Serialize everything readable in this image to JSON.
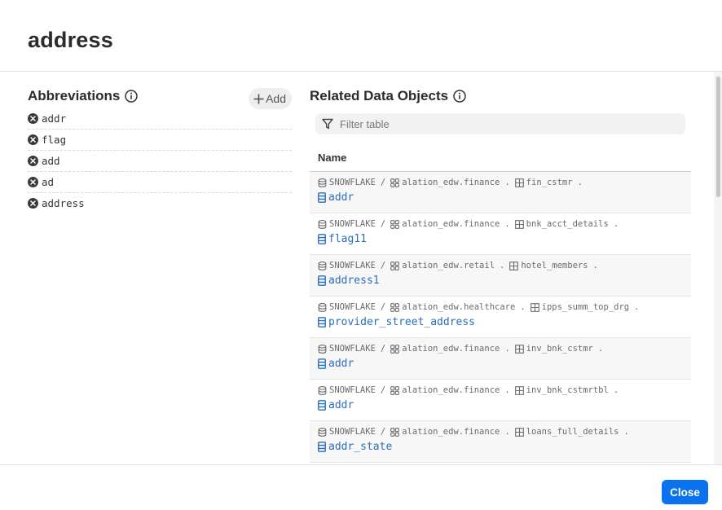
{
  "header": {
    "title": "address"
  },
  "abbreviations": {
    "title": "Abbreviations",
    "add_label": "Add",
    "items": [
      "addr",
      "flag",
      "add",
      "ad",
      "address"
    ]
  },
  "related": {
    "title": "Related Data Objects",
    "filter_placeholder": "Filter table",
    "column_header": "Name",
    "rows": [
      {
        "source": "SNOWFLAKE",
        "schema": "alation_edw.finance",
        "table": "fin_cstmr",
        "column": "addr"
      },
      {
        "source": "SNOWFLAKE",
        "schema": "alation_edw.finance",
        "table": "bnk_acct_details",
        "column": "flag11"
      },
      {
        "source": "SNOWFLAKE",
        "schema": "alation_edw.retail",
        "table": "hotel_members",
        "column": "address1"
      },
      {
        "source": "SNOWFLAKE",
        "schema": "alation_edw.healthcare",
        "table": "ipps_summ_top_drg",
        "column": "provider_street_address"
      },
      {
        "source": "SNOWFLAKE",
        "schema": "alation_edw.finance",
        "table": "inv_bnk_cstmr",
        "column": "addr"
      },
      {
        "source": "SNOWFLAKE",
        "schema": "alation_edw.finance",
        "table": "inv_bnk_cstmrtbl",
        "column": "addr"
      },
      {
        "source": "SNOWFLAKE",
        "schema": "alation_edw.finance",
        "table": "loans_full_details",
        "column": "addr_state"
      }
    ]
  },
  "footer": {
    "close_label": "Close"
  },
  "colors": {
    "accent": "#0a72ef",
    "link": "#2a6ebb"
  }
}
